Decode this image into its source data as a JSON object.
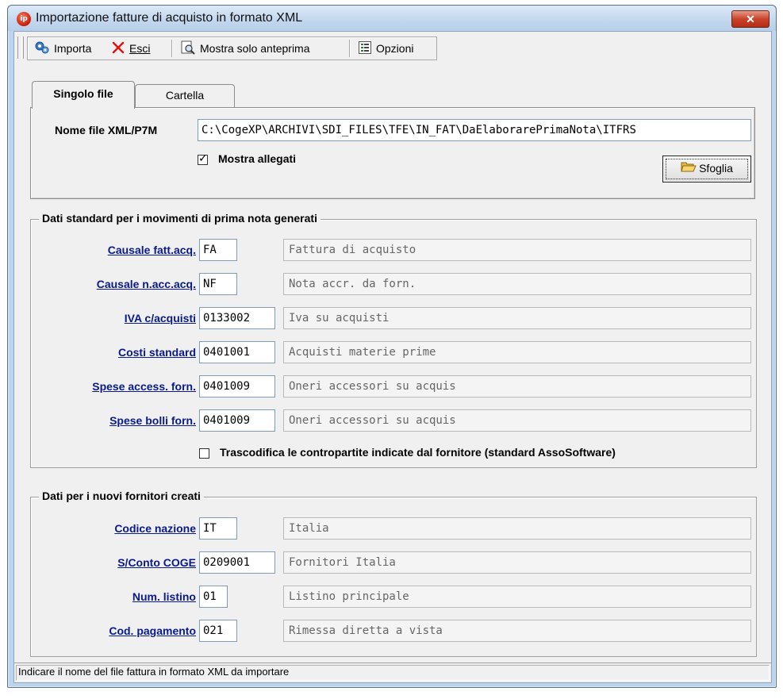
{
  "window": {
    "app_icon_text": "ip",
    "title": "Importazione fatture di acquisto in formato XML",
    "close_glyph": "✕"
  },
  "toolbar": {
    "importa": "Importa",
    "esci": "Esci",
    "anteprima": "Mostra solo anteprima",
    "opzioni": "Opzioni"
  },
  "tabs": {
    "singolo": "Singolo file",
    "cartella": "Cartella"
  },
  "file": {
    "label": "Nome file XML/P7M",
    "value": "C:\\CogeXP\\ARCHIVI\\SDI_FILES\\TFE\\IN_FAT\\DaElaborarePrimaNota\\ITFRS",
    "mostra_allegati": "Mostra allegati",
    "mostra_allegati_checked": true,
    "sfoglia": "Sfoglia"
  },
  "standard": {
    "legend": "Dati standard per i movimenti di prima nota generati",
    "rows": [
      {
        "label": "Causale fatt.acq.",
        "code": "FA",
        "desc": "Fattura di acquisto"
      },
      {
        "label": "Causale n.acc.acq.",
        "code": "NF",
        "desc": "Nota accr. da forn."
      },
      {
        "label": "IVA c/acquisti",
        "code": "0133002",
        "desc": "Iva su acquisti"
      },
      {
        "label": "Costi standard",
        "code": "0401001",
        "desc": "Acquisti materie prime"
      },
      {
        "label": "Spese access. forn.",
        "code": "0401009",
        "desc": "Oneri accessori su acquis"
      },
      {
        "label": "Spese bolli forn.",
        "code": "0401009",
        "desc": "Oneri accessori su acquis"
      }
    ],
    "trascodifica": "Trascodifica le contropartite indicate dal fornitore (standard AssoSoftware)",
    "trascodifica_checked": false
  },
  "fornitori": {
    "legend": "Dati per i nuovi fornitori creati",
    "rows": [
      {
        "label": "Codice nazione",
        "code": "IT",
        "desc": "Italia"
      },
      {
        "label": "S/Conto COGE",
        "code": "0209001",
        "desc": "Fornitori Italia"
      },
      {
        "label": "Num. listino",
        "code": "01",
        "desc": "Listino principale"
      },
      {
        "label": "Cod. pagamento",
        "code": "021",
        "desc": "Rimessa diretta a vista"
      }
    ]
  },
  "status": {
    "text": "Indicare il nome del file fattura in formato XML da importare"
  },
  "colors": {
    "link": "#0a1a8c",
    "title_bar": "#c4d8ee",
    "close": "#c8432a"
  }
}
